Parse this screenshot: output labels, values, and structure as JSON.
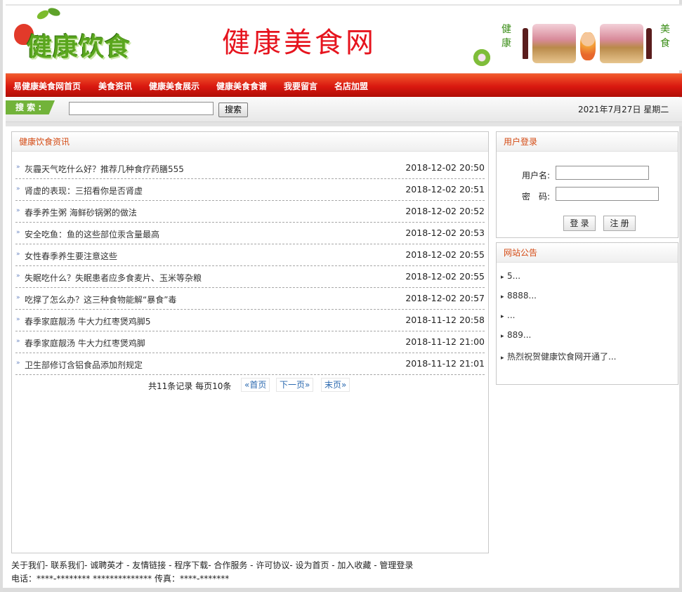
{
  "header": {
    "logo_text": "健康饮食",
    "site_title": "健康美食网",
    "banner_left_text": "健康",
    "banner_right_text": "美食"
  },
  "nav": {
    "items": [
      {
        "label": "易健康美食网首页"
      },
      {
        "label": "美食资讯"
      },
      {
        "label": "健康美食展示"
      },
      {
        "label": "健康美食食谱"
      },
      {
        "label": "我要留言"
      },
      {
        "label": "名店加盟"
      }
    ]
  },
  "search": {
    "label": "搜 索 :",
    "input_value": "",
    "button_label": "搜索",
    "date": "2021年7月27日 星期二"
  },
  "news": {
    "title": "健康饮食资讯",
    "items": [
      {
        "title": "灰霾天气吃什么好？推荐几种食疗药膳555",
        "date": "2018-12-02 20:50"
      },
      {
        "title": "肾虚的表现：三招看你是否肾虚",
        "date": "2018-12-02 20:51"
      },
      {
        "title": "春季养生粥 海鲜砂锅粥的做法",
        "date": "2018-12-02 20:52"
      },
      {
        "title": "安全吃鱼：鱼的这些部位汞含量最高",
        "date": "2018-12-02 20:53"
      },
      {
        "title": "女性春季养生要注意这些",
        "date": "2018-12-02 20:55"
      },
      {
        "title": "失眠吃什么？失眠患者应多食麦片、玉米等杂粮",
        "date": "2018-12-02 20:55"
      },
      {
        "title": "吃撑了怎么办？这三种食物能解“暴食”毒",
        "date": "2018-12-02 20:57"
      },
      {
        "title": "春季家庭靓汤 牛大力红枣煲鸡脚5",
        "date": "2018-11-12 20:58"
      },
      {
        "title": "春季家庭靓汤 牛大力红枣煲鸡脚",
        "date": "2018-11-12 21:00"
      },
      {
        "title": "卫生部修订含铝食品添加剂规定",
        "date": "2018-11-12 21:01"
      }
    ],
    "pager": {
      "info": "共11条记录 每页10条",
      "first": "«首页",
      "next": "下一页»",
      "last": "末页»"
    }
  },
  "login": {
    "title": "用户登录",
    "username_label": "用户名:",
    "password_label": "密　码:",
    "username_value": "",
    "password_value": "",
    "login_button": "登 录",
    "register_button": "注 册"
  },
  "notice": {
    "title": "网站公告",
    "items": [
      {
        "text": "5..."
      },
      {
        "text": "8888..."
      },
      {
        "text": "..."
      },
      {
        "text": "889..."
      },
      {
        "text": "热烈祝贺健康饮食网开通了..."
      }
    ]
  },
  "footer": {
    "links": "关于我们- 联系我们- 诚聘英才 - 友情链接 - 程序下载- 合作服务 - 许可协议- 设为首页 - 加入收藏 - 管理登录",
    "contact": "电话：****-******** ************** 传真：****-*******"
  },
  "colors": {
    "nav_red": "#d91810",
    "panel_title": "#d44a13",
    "search_green": "#72b33a",
    "site_title_red": "#e6141e",
    "link_blue": "#2c6ab0"
  }
}
